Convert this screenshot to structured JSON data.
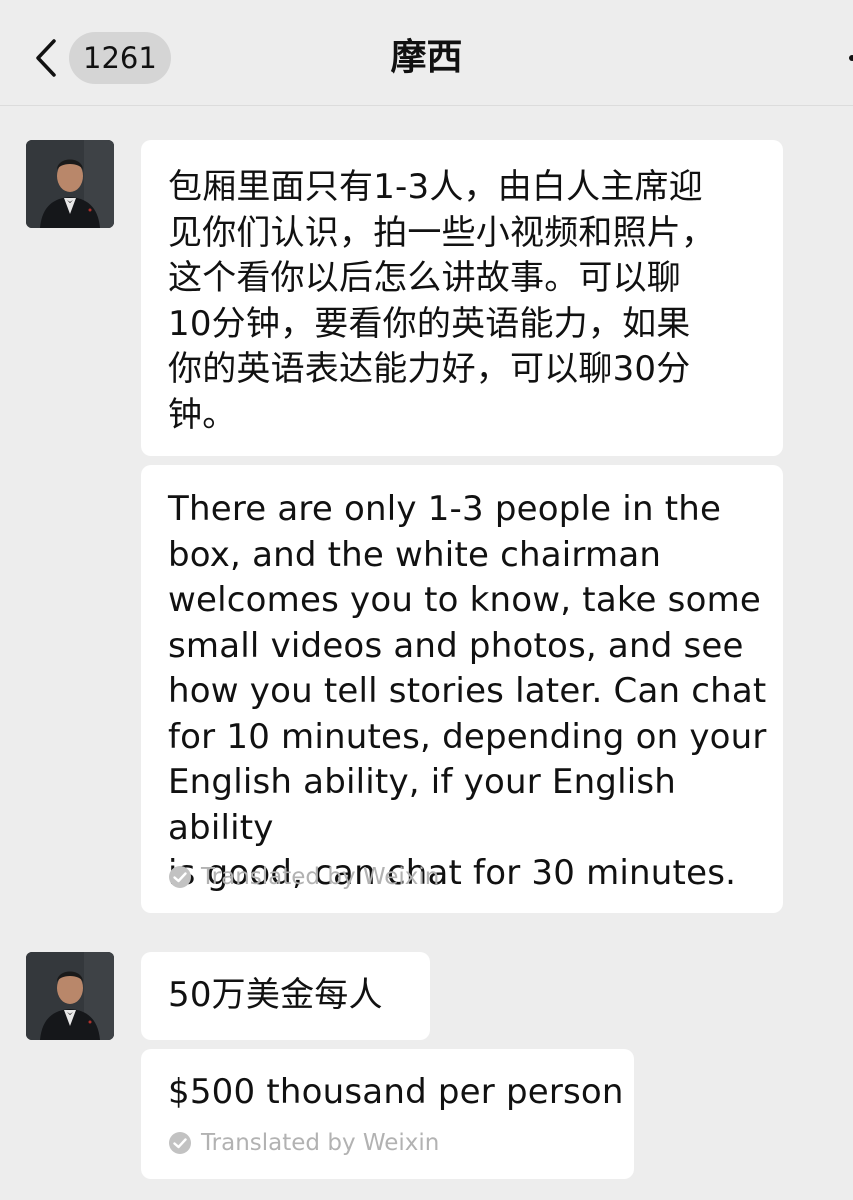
{
  "header": {
    "unread_count": "1261",
    "title": "摩西"
  },
  "messages": [
    {
      "original": "包厢里面只有1-3人，由白人主席迎\n见你们认识，拍一些小视频和照片，\n这个看你以后怎么讲故事。可以聊\n10分钟，要看你的英语能力，如果\n你的英语表达能力好，可以聊30分\n钟。",
      "translation": "There are only 1-3 people in the\nbox, and the white chairman\nwelcomes you to know, take some\nsmall videos and photos, and see\nhow you tell stories later. Can chat\nfor 10 minutes, depending on your\nEnglish ability, if your English ability\nis good, can chat for 30 minutes.",
      "translated_by": "Translated by Weixin"
    },
    {
      "original": "50万美金每人",
      "translation": "$500 thousand per person",
      "translated_by": "Translated by Weixin"
    }
  ],
  "icons": {
    "back": "chevron-left-icon",
    "translated": "check-circle-icon"
  }
}
